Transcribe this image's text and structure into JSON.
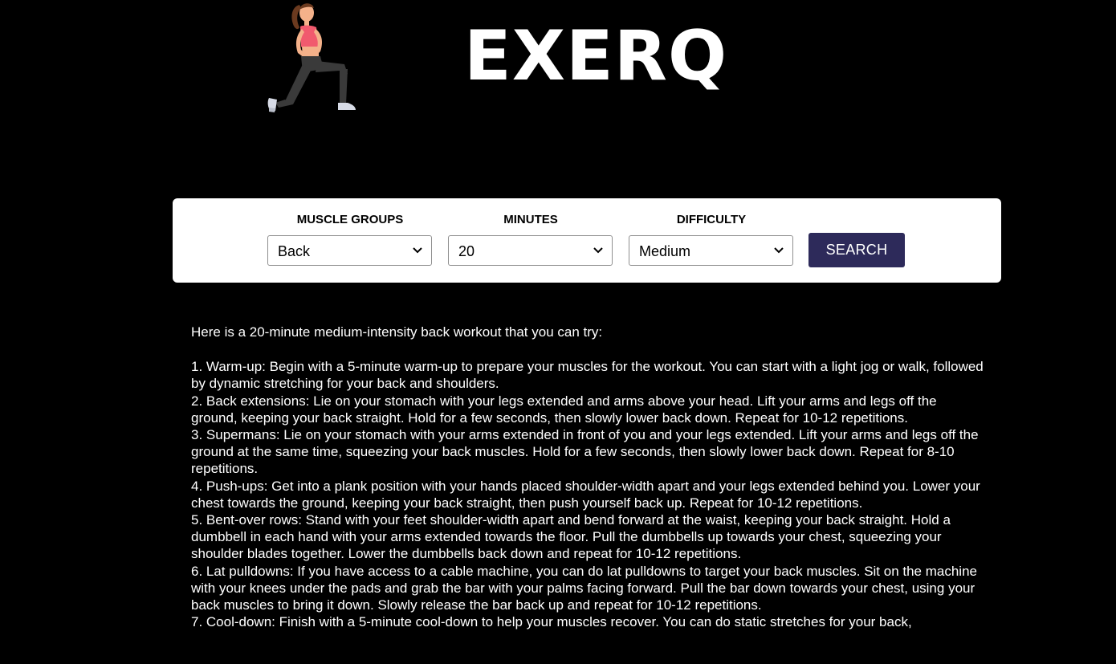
{
  "header": {
    "brand": "EXERQ",
    "logo_icon": "lunge-woman-illustration",
    "logo_colors": {
      "hair": "#6b3a1f",
      "skin": "#f4b18a",
      "top": "#f15a6e",
      "pants": "#3a3a3a",
      "shoes": "#d7dbe6"
    }
  },
  "search": {
    "muscle_label": "MUSCLE GROUPS",
    "muscle_value": "Back",
    "minutes_label": "MINUTES",
    "minutes_value": "20",
    "difficulty_label": "DIFFICULTY",
    "difficulty_value": "Medium",
    "button_label": "SEARCH",
    "button_color": "#2d2a5a"
  },
  "results": {
    "intro": "Here is a 20-minute medium-intensity back workout that you can try:",
    "steps": [
      "1.  Warm-up: Begin with a 5-minute warm-up to prepare your muscles for the workout. You can start with a light jog or walk, followed by dynamic stretching for your back and shoulders.",
      "2.  Back extensions: Lie on your stomach with your legs extended and arms above your head. Lift your arms and legs off the ground, keeping your back straight. Hold for a few seconds, then slowly lower back down. Repeat for 10-12 repetitions.",
      "3.  Supermans: Lie on your stomach with your arms extended in front of you and your legs extended. Lift your arms and legs off the ground at the same time, squeezing your back muscles. Hold for a few seconds, then slowly lower back down. Repeat for 8-10 repetitions.",
      "4.  Push-ups: Get into a plank position with your hands placed shoulder-width apart and your legs extended behind you. Lower your chest towards the ground, keeping your back straight, then push yourself back up. Repeat for 10-12 repetitions.",
      "5.  Bent-over rows: Stand with your feet shoulder-width apart and bend forward at the waist, keeping your back straight. Hold a dumbbell in each hand with your arms extended towards the floor. Pull the dumbbells up towards your chest, squeezing your shoulder blades together. Lower the dumbbells back down and repeat for 10-12 repetitions.",
      "6.  Lat pulldowns: If you have access to a cable machine, you can do lat pulldowns to target your back muscles. Sit on the machine with your knees under the pads and grab the bar with your palms facing forward. Pull the bar down towards your chest, using your back muscles to bring it down. Slowly release the bar back up and repeat for 10-12 repetitions.",
      "7.  Cool-down: Finish with a 5-minute cool-down to help your muscles recover. You can do static stretches for your back,"
    ]
  }
}
